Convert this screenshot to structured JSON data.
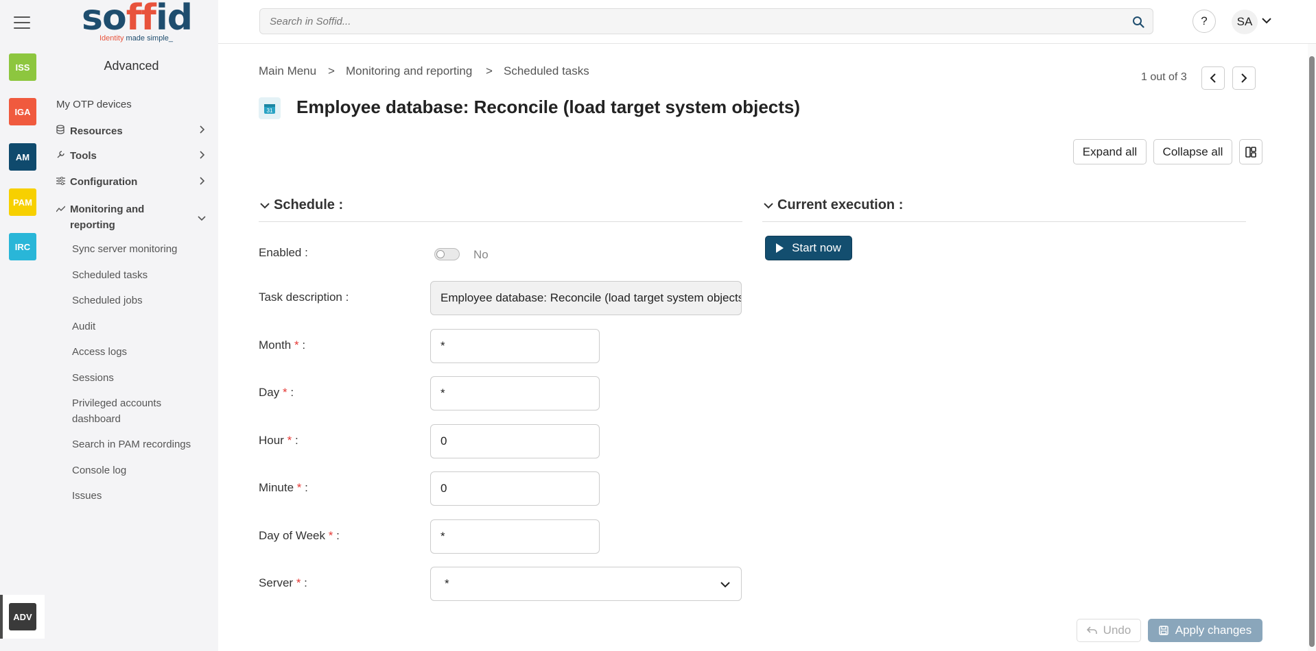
{
  "rail": {
    "modules": [
      {
        "label": "ISS",
        "color": "#8dc63f"
      },
      {
        "label": "IGA",
        "color": "#f05a3e"
      },
      {
        "label": "AM",
        "color": "#0f4a6d"
      },
      {
        "label": "PAM",
        "color": "#f7d000"
      },
      {
        "label": "IRC",
        "color": "#29b6d8"
      }
    ],
    "active_module": {
      "label": "ADV",
      "color": "#3a3a3a"
    }
  },
  "logo": {
    "word_a": "so",
    "word_b": "ff",
    "word_c": "id",
    "tag_a": "Identity ",
    "tag_b": "made simple_"
  },
  "sidebar": {
    "title": "Advanced",
    "items": [
      {
        "label": "My OTP devices"
      },
      {
        "label": "Resources",
        "icon": "database-icon"
      },
      {
        "label": "Tools",
        "icon": "wrench-icon"
      },
      {
        "label": "Configuration",
        "icon": "sliders-icon"
      },
      {
        "label": "Monitoring and reporting",
        "icon": "chart-line-icon"
      }
    ],
    "subitems": [
      "Sync server monitoring",
      "Scheduled tasks",
      "Scheduled jobs",
      "Audit",
      "Access logs",
      "Sessions",
      "Privileged accounts dashboard",
      "Search in PAM recordings",
      "Console log",
      "Issues"
    ]
  },
  "topbar": {
    "search_placeholder": "Search in Soffid...",
    "help": "?",
    "user_initials": "SA"
  },
  "breadcrumb": [
    "Main Menu",
    "Monitoring and reporting",
    "Scheduled tasks"
  ],
  "breadcrumb_sep": ">",
  "pager": {
    "text": "1 out of 3"
  },
  "page": {
    "title": "Employee database: Reconcile (load target system objects)"
  },
  "actions": {
    "expand_all": "Expand all",
    "collapse_all": "Collapse all"
  },
  "schedule": {
    "heading": "Schedule :",
    "enabled_label": "Enabled :",
    "enabled_value": "No",
    "task_description_label": "Task description :",
    "task_description_value": "Employee database: Reconcile (load target system objects)",
    "fields": [
      {
        "label": "Month",
        "value": "*"
      },
      {
        "label": "Day",
        "value": "*"
      },
      {
        "label": "Hour",
        "value": "0"
      },
      {
        "label": "Minute",
        "value": "0"
      },
      {
        "label": "Day of Week",
        "value": "*"
      }
    ],
    "server_label": "Server",
    "server_value": "*",
    "required_mark": "*",
    "suffix": " :"
  },
  "execution": {
    "heading": "Current execution :",
    "start_now": "Start now"
  },
  "footer": {
    "undo": "Undo",
    "apply": "Apply changes"
  },
  "colors": {
    "accent": "#134e6f",
    "required": "#e53935",
    "apply_disabled": "#8aa6bb"
  }
}
